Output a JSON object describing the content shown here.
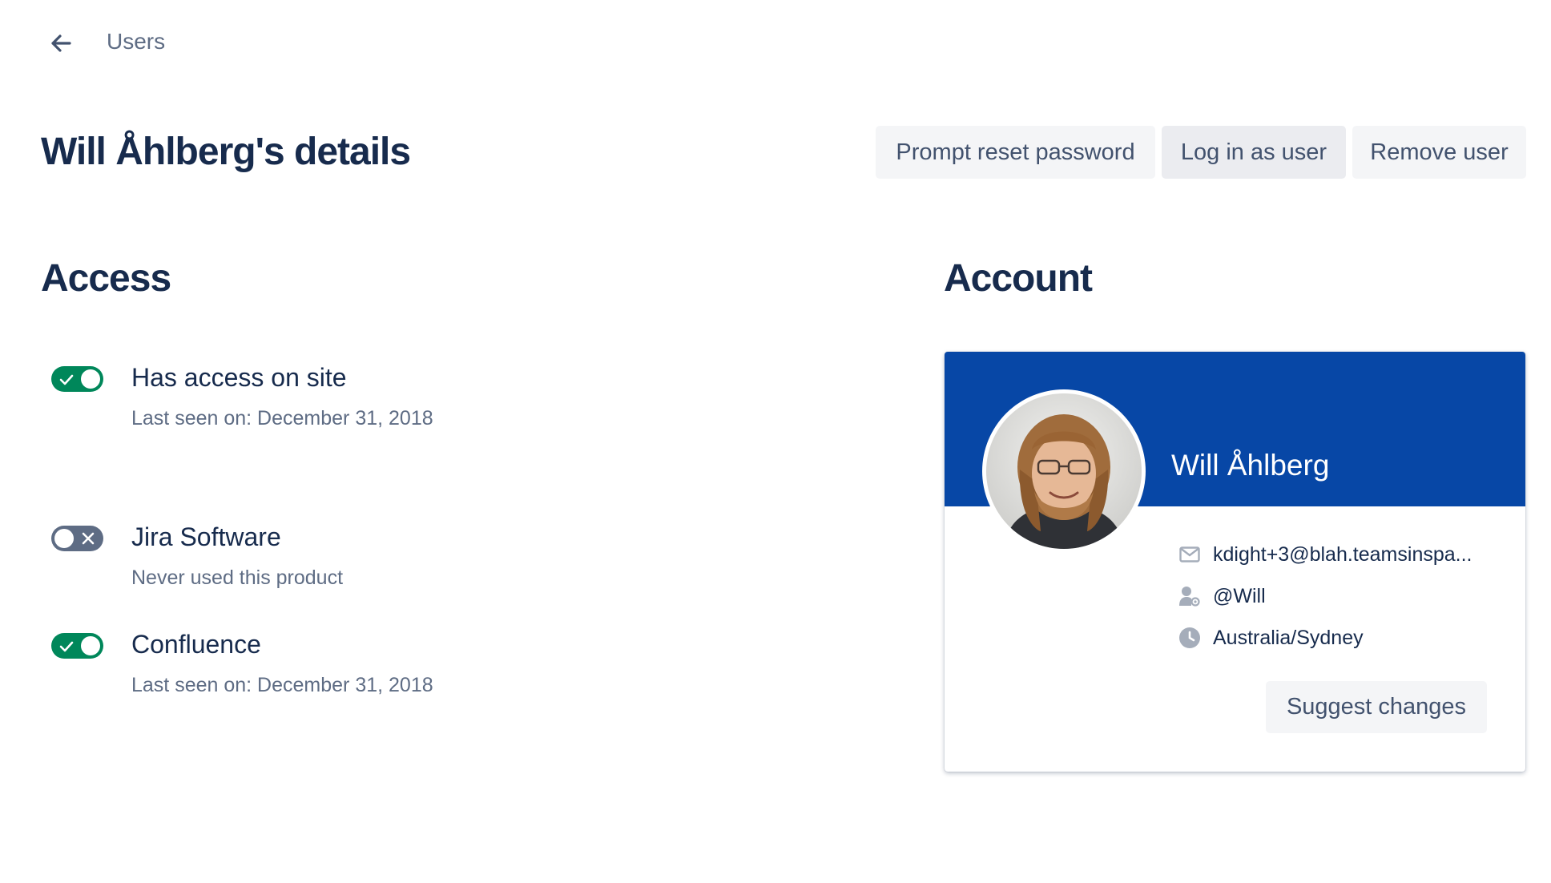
{
  "header": {
    "breadcrumb": "Users"
  },
  "page": {
    "title": "Will Åhlberg's details"
  },
  "actions": {
    "reset_password": "Prompt reset password",
    "login_as_user": "Log in as user",
    "remove_user": "Remove user"
  },
  "access": {
    "heading": "Access",
    "items": [
      {
        "name": "Has access on site",
        "status": "Last seen on: December 31, 2018",
        "enabled": true
      },
      {
        "name": "Jira Software",
        "status": "Never used this product",
        "enabled": false
      },
      {
        "name": "Confluence",
        "status": "Last seen on: December 31, 2018",
        "enabled": true
      }
    ]
  },
  "account": {
    "heading": "Account",
    "name": "Will Åhlberg",
    "email": "kdight+3@blah.teamsinspa...",
    "username": "@Will",
    "timezone": "Australia/Sydney",
    "suggest_changes": "Suggest changes"
  },
  "colors": {
    "banner": "#0747A6",
    "toggle_on": "#00875A",
    "toggle_off": "#5E6C84",
    "heading": "#172B4D",
    "subtle": "#5E6C84"
  }
}
